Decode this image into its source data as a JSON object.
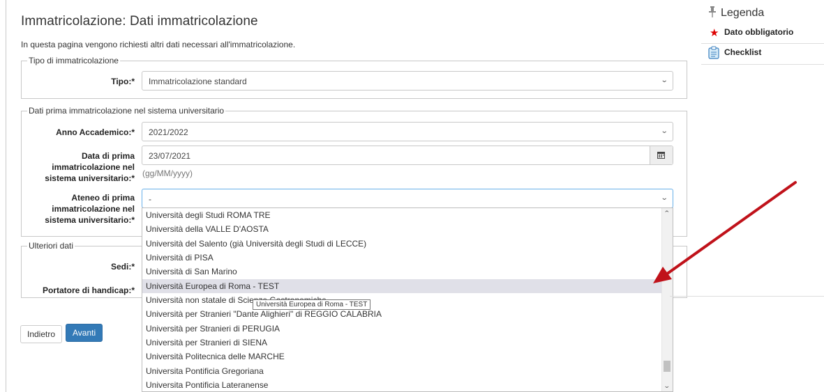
{
  "page": {
    "title": "Immatricolazione: Dati immatricolazione",
    "intro": "In questa pagina vengono richiesti altri dati necessari all'immatricolazione."
  },
  "tipo_section": {
    "legend": "Tipo di immatricolazione",
    "tipo_label": "Tipo:*",
    "tipo_value": "Immatricolazione standard"
  },
  "dati_section": {
    "legend": "Dati prima immatricolazione nel sistema universitario",
    "anno_label": "Anno Accademico:*",
    "anno_value": "2021/2022",
    "data_label": "Data di prima immatricolazione nel sistema universitario:*",
    "data_value": "23/07/2021",
    "data_hint": "(gg/MM/yyyy)",
    "ateneo_label": "Ateneo di prima immatricolazione nel sistema universitario:*",
    "ateneo_value": "-"
  },
  "ulteriori_section": {
    "legend": "Ulteriori dati",
    "sedi_label": "Sedi:*",
    "handicap_label": "Portatore di handicap:*"
  },
  "dropdown": {
    "options": [
      "Università degli Studi ROMA TRE",
      "Università della VALLE D'AOSTA",
      "Università del Salento (già Università degli Studi di LECCE)",
      "Università di PISA",
      "Università di San Marino",
      "Università Europea di Roma - TEST",
      "Università non statale di Scienze Gastronomiche",
      "Università per Stranieri \"Dante Alighieri\" di REGGIO CALABRIA",
      "Università per Stranieri di PERUGIA",
      "Università per Stranieri di SIENA",
      "Università Politecnica delle MARCHE",
      "Universita Pontificia Gregoriana",
      "Universita Pontificia Lateranense"
    ],
    "highlighted": "Università Europea di Roma - TEST",
    "tooltip": "Università  Europea di Roma - TEST"
  },
  "buttons": {
    "back": "Indietro",
    "next": "Avanti"
  },
  "sidebar": {
    "title": "Legenda",
    "required": "Dato obbligatorio",
    "checklist": "Checklist"
  },
  "colors": {
    "primary": "#337ab7",
    "required_star": "#dd0000",
    "arrow": "#c0121a"
  }
}
